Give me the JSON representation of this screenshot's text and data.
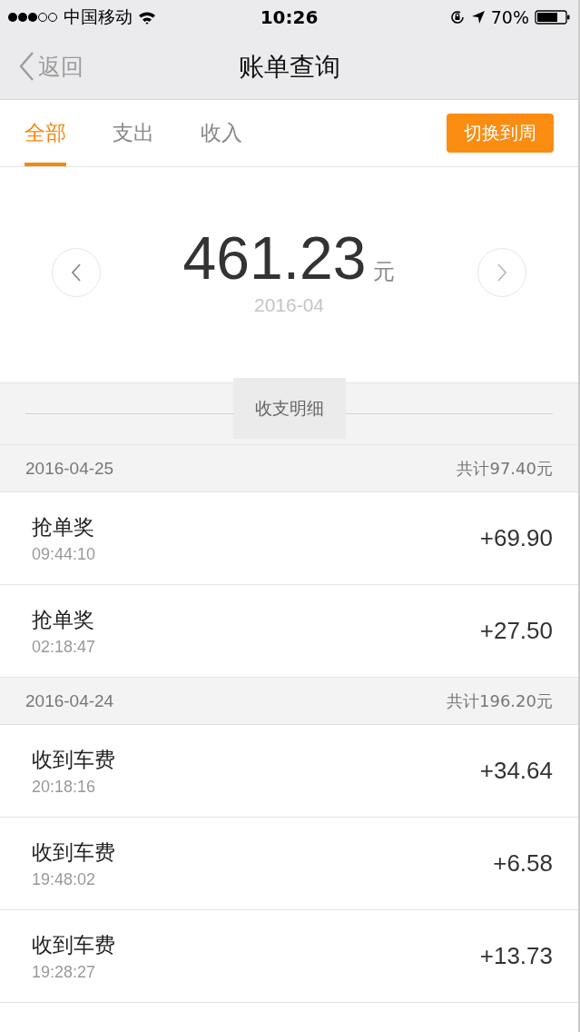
{
  "status_bar": {
    "carrier": "中国移动",
    "time": "10:26",
    "battery": "70%"
  },
  "nav": {
    "back": "返回",
    "title": "账单查询"
  },
  "tabs": [
    {
      "label": "全部",
      "selected": true
    },
    {
      "label": "支出",
      "selected": false
    },
    {
      "label": "收入",
      "selected": false
    }
  ],
  "switch_button": "切换到周",
  "summary": {
    "amount": "461.23",
    "unit": "元",
    "month": "2016-04"
  },
  "section_title": "收支明细",
  "groups": [
    {
      "date": "2016-04-25",
      "total": "共计97.40元",
      "items": [
        {
          "name": "抢单奖",
          "time": "09:44:10",
          "amount": "+69.90"
        },
        {
          "name": "抢单奖",
          "time": "02:18:47",
          "amount": "+27.50"
        }
      ]
    },
    {
      "date": "2016-04-24",
      "total": "共计196.20元",
      "items": [
        {
          "name": "收到车费",
          "time": "20:18:16",
          "amount": "+34.64"
        },
        {
          "name": "收到车费",
          "time": "19:48:02",
          "amount": "+6.58"
        },
        {
          "name": "收到车费",
          "time": "19:28:27",
          "amount": "+13.73"
        }
      ]
    }
  ]
}
